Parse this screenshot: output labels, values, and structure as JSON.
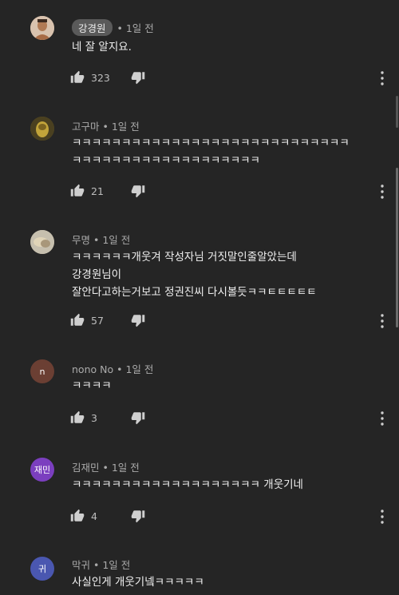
{
  "comments": [
    {
      "author": "강경원",
      "time": "1일 전",
      "lines": [
        "네 잘 알지요."
      ],
      "likes": "323",
      "avatar_icon": "user-photo"
    },
    {
      "author": "고구마",
      "time": "1일 전",
      "lines": [
        "ㅋㅋㅋㅋㅋㅋㅋㅋㅋㅋㅋㅋㅋㅋㅋㅋㅋㅋㅋㅋㅋㅋㅋㅋㅋㅋㅋㅋ",
        "ㅋㅋㅋㅋㅋㅋㅋㅋㅋㅋㅋㅋㅋㅋㅋㅋㅋㅋㅋ"
      ],
      "likes": "21",
      "avatar_icon": "user-photo"
    },
    {
      "author": "무명",
      "time": "1일 전",
      "lines": [
        "ㅋㅋㅋㅋㅋㅋ개웃겨 작성자님 거짓말인줄알았는데",
        "강경원님이",
        "잘안다고하는거보고 정권진씨 다시볼듯ㅋㅋㅌㅌㅌㅌㅌ"
      ],
      "likes": "57",
      "avatar_icon": "user-photo"
    },
    {
      "author": "nono No",
      "time": "1일 전",
      "lines": [
        "ㅋㅋㅋㅋ"
      ],
      "likes": "3",
      "avatar_letter": "n",
      "avatar_color": "#6b3f33"
    },
    {
      "author": "김재민",
      "time": "1일 전",
      "lines": [
        "ㅋㅋㅋㅋㅋㅋㅋㅋㅋㅋㅋㅋㅋㅋㅋㅋㅋㅋㅋ 개웃기네"
      ],
      "likes": "4",
      "avatar_letter": "재민",
      "avatar_color": "#7b3fbf"
    },
    {
      "author": "막귀",
      "time": "1일 전",
      "lines": [
        "사실인게 개웃기넼ㅋㅋㅋㅋㅋ"
      ],
      "likes": "",
      "avatar_letter": "귀",
      "avatar_color": "#4a57b0"
    }
  ],
  "separator": "•"
}
